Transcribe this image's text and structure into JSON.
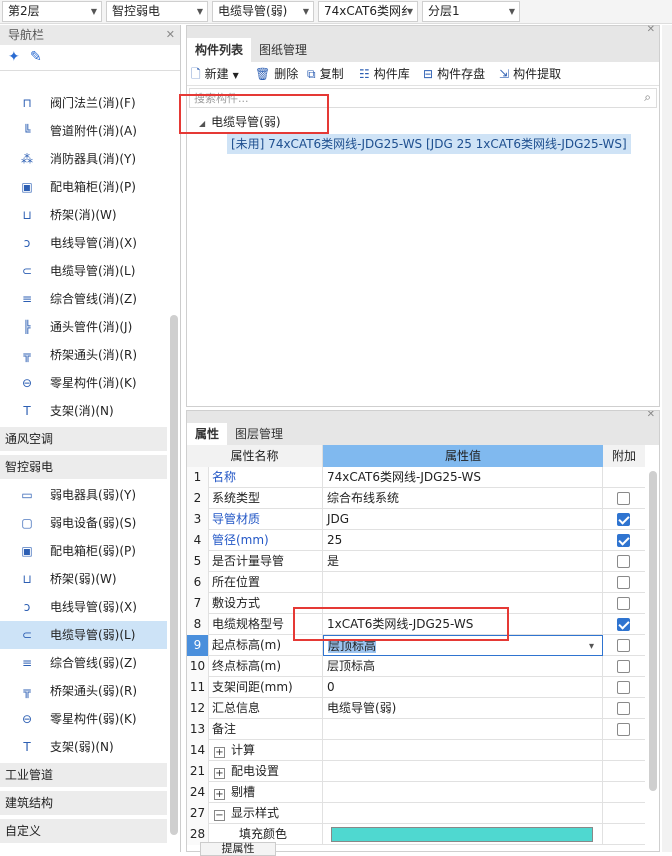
{
  "top_selects": [
    {
      "value": "第2层"
    },
    {
      "value": "智控弱电"
    },
    {
      "value": "电缆导管(弱)"
    },
    {
      "value": "74xCAT6类网纟"
    },
    {
      "value": "分层1"
    }
  ],
  "nav": {
    "title": "导航栏",
    "items_fire": [
      {
        "label": "阀门法兰(消)(F)",
        "icon": "valve-flange-icon"
      },
      {
        "label": "管道附件(消)(A)",
        "icon": "pipe-fitting-icon"
      },
      {
        "label": "消防器具(消)(Y)",
        "icon": "fire-appliance-icon"
      },
      {
        "label": "配电箱柜(消)(P)",
        "icon": "distribution-box-icon"
      },
      {
        "label": "桥架(消)(W)",
        "icon": "cable-tray-icon"
      },
      {
        "label": "电线导管(消)(X)",
        "icon": "wire-conduit-icon"
      },
      {
        "label": "电缆导管(消)(L)",
        "icon": "cable-conduit-icon"
      },
      {
        "label": "综合管线(消)(Z)",
        "icon": "combined-pipeline-icon"
      },
      {
        "label": "通头管件(消)(J)",
        "icon": "tee-fitting-icon"
      },
      {
        "label": "桥架通头(消)(R)",
        "icon": "tray-tee-icon"
      },
      {
        "label": "零星构件(消)(K)",
        "icon": "misc-component-icon"
      },
      {
        "label": "支架(消)(N)",
        "icon": "bracket-icon"
      }
    ],
    "cat_hvac": "通风空调",
    "cat_weak": "智控弱电",
    "items_weak": [
      {
        "label": "弱电器具(弱)(Y)",
        "icon": "weak-appliance-icon"
      },
      {
        "label": "弱电设备(弱)(S)",
        "icon": "weak-device-icon"
      },
      {
        "label": "配电箱柜(弱)(P)",
        "icon": "distribution-box-icon"
      },
      {
        "label": "桥架(弱)(W)",
        "icon": "cable-tray-icon"
      },
      {
        "label": "电线导管(弱)(X)",
        "icon": "wire-conduit-icon"
      },
      {
        "label": "电缆导管(弱)(L)",
        "icon": "cable-conduit-icon"
      },
      {
        "label": "综合管线(弱)(Z)",
        "icon": "combined-pipeline-icon"
      },
      {
        "label": "桥架通头(弱)(R)",
        "icon": "tray-tee-icon"
      },
      {
        "label": "零星构件(弱)(K)",
        "icon": "misc-component-icon"
      },
      {
        "label": "支架(弱)(N)",
        "icon": "bracket-icon"
      }
    ],
    "cat_industrial": "工业管道",
    "cat_building": "建筑结构",
    "cat_custom": "自定义"
  },
  "component_panel": {
    "tab_list": "构件列表",
    "tab_drawing": "图纸管理",
    "toolbar": {
      "new": "新建",
      "delete": "删除",
      "copy": "复制",
      "library": "构件库",
      "save": "构件存盘",
      "extract": "构件提取"
    },
    "search_placeholder": "搜索构件...",
    "tree_root": "电缆导管(弱)",
    "tree_child": "[未用] 74xCAT6类网线-JDG25-WS [JDG 25 1xCAT6类网线-JDG25-WS]"
  },
  "props_panel": {
    "tab_props": "属性",
    "tab_layers": "图层管理",
    "col_name": "属性名称",
    "col_value": "属性值",
    "col_add": "附加",
    "rows": [
      {
        "num": "1",
        "name": "名称",
        "value": "74xCAT6类网线-JDG25-WS",
        "check": null,
        "blue": true
      },
      {
        "num": "2",
        "name": "系统类型",
        "value": "综合布线系统",
        "check": false,
        "blue": false
      },
      {
        "num": "3",
        "name": "导管材质",
        "value": "JDG",
        "check": true,
        "blue": true
      },
      {
        "num": "4",
        "name": "管径(mm)",
        "value": "25",
        "check": true,
        "blue": true
      },
      {
        "num": "5",
        "name": "是否计量导管",
        "value": "是",
        "check": false,
        "blue": false
      },
      {
        "num": "6",
        "name": "所在位置",
        "value": "",
        "check": false,
        "blue": false
      },
      {
        "num": "7",
        "name": "敷设方式",
        "value": "",
        "check": false,
        "blue": false
      },
      {
        "num": "8",
        "name": "电缆规格型号",
        "value": "1xCAT6类网线-JDG25-WS",
        "check": true,
        "blue": false
      },
      {
        "num": "9",
        "name": "起点标高(m)",
        "value": "层顶标高",
        "check": false,
        "blue": false
      },
      {
        "num": "10",
        "name": "终点标高(m)",
        "value": "层顶标高",
        "check": false,
        "blue": false
      },
      {
        "num": "11",
        "name": "支架间距(mm)",
        "value": "0",
        "check": false,
        "blue": false
      },
      {
        "num": "12",
        "name": "汇总信息",
        "value": "电缆导管(弱)",
        "check": false,
        "blue": false
      },
      {
        "num": "13",
        "name": "备注",
        "value": "",
        "check": false,
        "blue": false
      }
    ],
    "groups": [
      {
        "num": "14",
        "label": "计算",
        "sign": "+"
      },
      {
        "num": "21",
        "label": "配电设置",
        "sign": "+"
      },
      {
        "num": "24",
        "label": "剔槽",
        "sign": "+"
      },
      {
        "num": "27",
        "label": "显示样式",
        "sign": "−"
      }
    ],
    "sub_row": {
      "num": "28",
      "label": "填充颜色",
      "color": "#4fd8d0"
    },
    "bottom_button": "提属性"
  }
}
